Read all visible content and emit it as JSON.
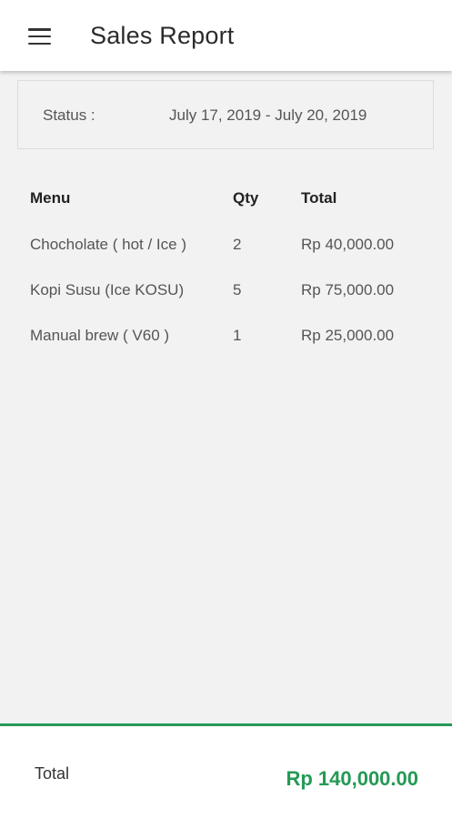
{
  "app_bar": {
    "title": "Sales Report",
    "menu_icon": "hamburger-menu-icon"
  },
  "status": {
    "label": "Status :",
    "value": "July 17, 2019 - July 20, 2019"
  },
  "table": {
    "headers": {
      "menu": "Menu",
      "qty": "Qty",
      "total": "Total"
    },
    "rows": [
      {
        "menu": "Chocholate ( hot / Ice )",
        "qty": "2",
        "total": "Rp 40,000.00"
      },
      {
        "menu": "Kopi Susu (Ice KOSU)",
        "qty": "5",
        "total": "Rp 75,000.00"
      },
      {
        "menu": "Manual brew ( V60 )",
        "qty": "1",
        "total": "Rp 25,000.00"
      }
    ]
  },
  "footer": {
    "label": "Total",
    "value": "Rp 140,000.00"
  },
  "colors": {
    "accent": "#239a55",
    "background": "#f2f2f2",
    "app_bar": "#ffffff"
  }
}
